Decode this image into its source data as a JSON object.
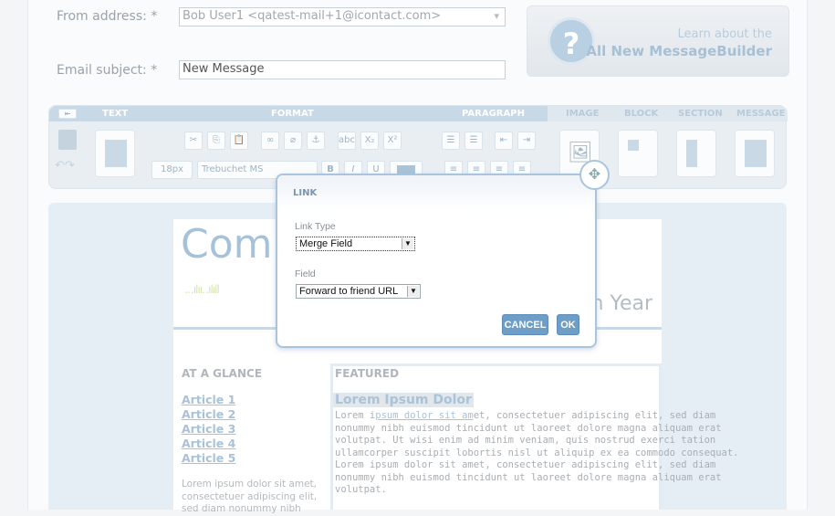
{
  "form": {
    "from_label": "From address:",
    "from_required": "*",
    "from_value": "Bob User1 <qatest-mail+1@icontact.com>",
    "subject_label": "Email subject:",
    "subject_required": "*",
    "subject_value": "New Message"
  },
  "promo": {
    "icon": "question-icon",
    "line1": "Learn about the",
    "line2": "All New MessageBuilder"
  },
  "toolbar": {
    "sections": [
      "TEXT",
      "FORMAT",
      "PARAGRAPH",
      "IMAGE",
      "BLOCK",
      "SECTION",
      "MESSAGE"
    ],
    "font_size": "18px",
    "font_family": "Trebuchet MS",
    "bold": "B",
    "italic": "I",
    "underline": "U",
    "subscript": "X₂",
    "superscript": "X²"
  },
  "email": {
    "title_left": "Comp",
    "title_right": "th Year",
    "glance": "AT A GLANCE",
    "articles": [
      "Article 1",
      "Article 2",
      "Article 3",
      "Article 4",
      "Article 5"
    ],
    "glance_text": "Lorem ipsum dolor sit amet,\nconsectetuer adipiscing elit,\nsed diam nonummy nibh",
    "featured": "FEATURED",
    "featured_title": "Lorem Ipsum Dolor",
    "featured_text_start": "Lorem i",
    "featured_link": "psum dolor sit am",
    "featured_text": "et, consectetuer adipiscing elit, sed diam\nnonummy nibh euismod tincidunt ut laoreet dolore magna aliquam erat\nvolutpat. Ut wisi enim ad minim veniam, quis nostrud exerci tation\nullamcorper suscipit lobortis nisl ut aliquip ex ea commodo consequat.\nLorem ipsum dolor sit amet, consectetuer adipiscing elit, sed diam\nnonummy nibh euismod tincidunt ut laoreet dolore magna aliquam erat\nvolutpat."
  },
  "dialog": {
    "title": "LINK",
    "link_type_label": "Link Type",
    "link_type_value": "Merge Field",
    "field_label": "Field",
    "field_value": "Forward to friend URL",
    "cancel": "CANCEL",
    "ok": "OK"
  },
  "colors": {
    "accent": "#6e9dc6",
    "link": "#a8c2d8"
  }
}
